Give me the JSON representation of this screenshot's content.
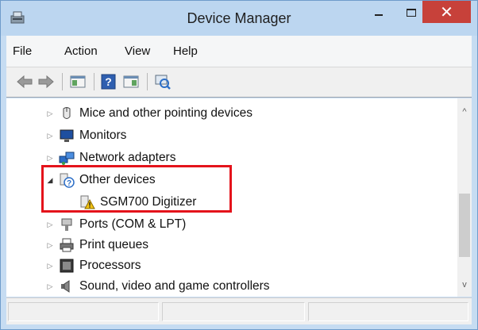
{
  "window": {
    "title": "Device Manager"
  },
  "colors": {
    "title_bar": "#bcd6f0",
    "close_button": "#c7413a",
    "highlight": "#e4131b",
    "selection_tree_bg": "#ffffff"
  },
  "menu": {
    "items": [
      "File",
      "Action",
      "View",
      "Help"
    ]
  },
  "toolbar": {
    "icons": [
      "back-arrow-icon",
      "forward-arrow-icon",
      "show-hide-console-tree-icon",
      "help-icon",
      "properties-icon",
      "scan-hardware-icon"
    ]
  },
  "tree": {
    "items": [
      {
        "label": "Mice and other pointing devices",
        "icon": "mouse-icon",
        "expanded": false
      },
      {
        "label": "Monitors",
        "icon": "monitor-icon",
        "expanded": false
      },
      {
        "label": "Network adapters",
        "icon": "network-adapter-icon",
        "expanded": false
      },
      {
        "label": "Other devices",
        "icon": "unknown-device-icon",
        "expanded": true
      },
      {
        "label": "SGM700 Digitizer",
        "icon": "warning-device-icon",
        "child": true
      },
      {
        "label": "Ports (COM & LPT)",
        "icon": "port-icon",
        "expanded": false
      },
      {
        "label": "Print queues",
        "icon": "printer-icon",
        "expanded": false
      },
      {
        "label": "Processors",
        "icon": "processor-icon",
        "expanded": false
      },
      {
        "label": "Sound, video and game controllers",
        "icon": "speaker-icon",
        "expanded": false
      }
    ]
  },
  "scrollbar": {
    "up_arrow": "^",
    "down_arrow": "v"
  },
  "status": {
    "text": ""
  }
}
